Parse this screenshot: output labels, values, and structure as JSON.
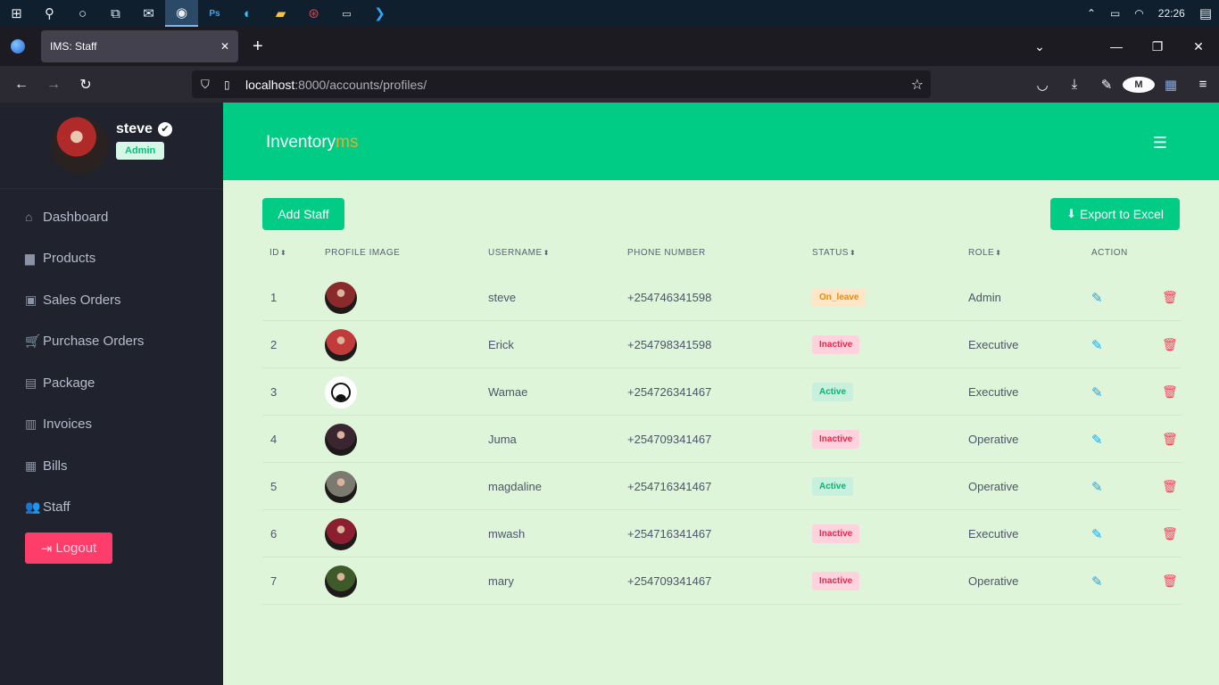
{
  "taskbar": {
    "icons": [
      "windows-icon",
      "search-icon",
      "cortana-icon",
      "task-view-icon",
      "mail-icon",
      "firefox-icon",
      "photoshop-icon",
      "edge-icon",
      "file-explorer-icon",
      "record-icon",
      "terminal-icon",
      "vscode-icon"
    ],
    "time": "22:26"
  },
  "browser": {
    "tab_title": "IMS: Staff",
    "url_host": "localhost",
    "url_path": ":8000/accounts/profiles/"
  },
  "sidebar": {
    "user_name": "steve",
    "user_role": "Admin",
    "items": [
      {
        "label": "Dashboard",
        "icon": "home-icon",
        "glyph": "⌂"
      },
      {
        "label": "Products",
        "icon": "folder-icon",
        "glyph": "▆"
      },
      {
        "label": "Sales Orders",
        "icon": "shopping-bag-icon",
        "glyph": "▣"
      },
      {
        "label": "Purchase Orders",
        "icon": "cart-icon",
        "glyph": "🛒"
      },
      {
        "label": "Package",
        "icon": "box-icon",
        "glyph": "▤"
      },
      {
        "label": "Invoices",
        "icon": "invoice-icon",
        "glyph": "▥"
      },
      {
        "label": "Bills",
        "icon": "money-icon",
        "glyph": "▦"
      },
      {
        "label": "Staff",
        "icon": "people-icon",
        "glyph": "👥"
      }
    ],
    "logout_label": "Logout"
  },
  "header": {
    "brand_main": "Inventory",
    "brand_accent": "ms"
  },
  "toolbar": {
    "add_label": "Add Staff",
    "export_label": "Export to Excel"
  },
  "table": {
    "columns": {
      "id": "ID",
      "profile_image": "PROFILE IMAGE",
      "username": "USERNAME",
      "phone": "PHONE NUMBER",
      "status": "STATUS",
      "role": "ROLE",
      "action": "ACTION"
    },
    "rows": [
      {
        "id": "1",
        "username": "steve",
        "phone": "+254746341598",
        "status": "On_leave",
        "status_kind": "onleave",
        "role": "Admin",
        "avatar": "#8a2a2a"
      },
      {
        "id": "2",
        "username": "Erick",
        "phone": "+254798341598",
        "status": "Inactive",
        "status_kind": "inactive",
        "role": "Executive",
        "avatar": "#c23b3b"
      },
      {
        "id": "3",
        "username": "Wamae",
        "phone": "+254726341467",
        "status": "Active",
        "status_kind": "active",
        "role": "Executive",
        "avatar": "default"
      },
      {
        "id": "4",
        "username": "Juma",
        "phone": "+254709341467",
        "status": "Inactive",
        "status_kind": "inactive",
        "role": "Operative",
        "avatar": "#3a2530"
      },
      {
        "id": "5",
        "username": "magdaline",
        "phone": "+254716341467",
        "status": "Active",
        "status_kind": "active",
        "role": "Operative",
        "avatar": "#7a7a70"
      },
      {
        "id": "6",
        "username": "mwash",
        "phone": "+254716341467",
        "status": "Inactive",
        "status_kind": "inactive",
        "role": "Executive",
        "avatar": "#8c1f2f"
      },
      {
        "id": "7",
        "username": "mary",
        "phone": "+254709341467",
        "status": "Inactive",
        "status_kind": "inactive",
        "role": "Operative",
        "avatar": "#3e5a2a"
      }
    ]
  },
  "colors": {
    "accent": "#00cc85",
    "sidebar_bg": "#20222e",
    "content_bg": "#dff5da",
    "danger": "#ff3d6b",
    "brand_accent": "#f5a623"
  }
}
